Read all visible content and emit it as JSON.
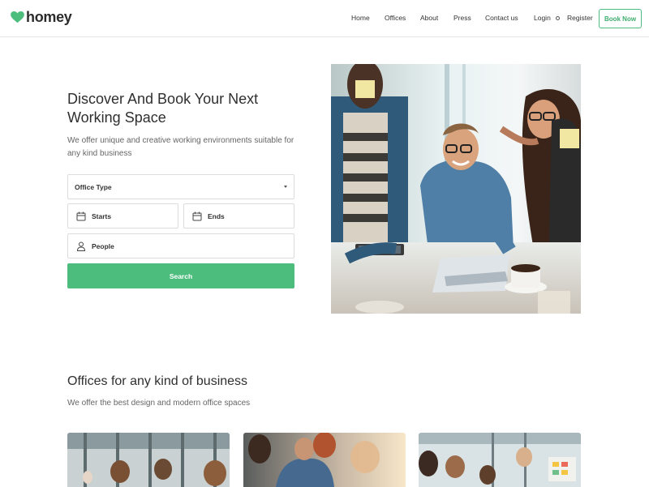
{
  "brand": {
    "name": "homey",
    "accent": "#4dbd7d"
  },
  "nav": {
    "items": [
      "Home",
      "Offices",
      "About",
      "Press",
      "Contact us"
    ],
    "login": "Login",
    "register": "Register",
    "book_now": "Book Now"
  },
  "hero": {
    "title": "Discover And Book Your Next Working Space",
    "subtitle": "We offer unique and creative working environments suitable for any kind business",
    "image": "people-working-at-cafe-table-photo"
  },
  "search_form": {
    "office_type": "Office Type",
    "starts": "Starts",
    "ends": "Ends",
    "people": "People",
    "search_label": "Search"
  },
  "offices_section": {
    "title": "Offices for any kind of business",
    "subtitle": "We offer the best design and modern office spaces",
    "cards": [
      {
        "image": "office-team-photo-1"
      },
      {
        "image": "office-team-photo-2"
      },
      {
        "image": "office-team-photo-3"
      }
    ]
  }
}
